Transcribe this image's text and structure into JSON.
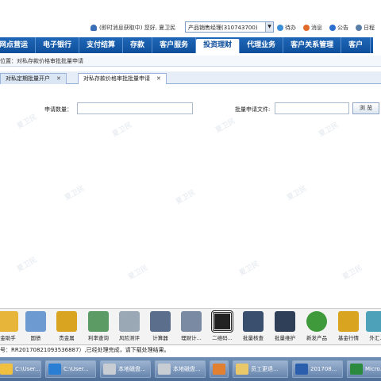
{
  "topbar": {
    "message": "(即时消息获取中)",
    "greeting": "您好, 夏卫民",
    "role": "产品销售经理(310743700)",
    "tools": [
      "待办",
      "消息",
      "公告",
      "日程"
    ]
  },
  "nav": [
    "网点营运",
    "电子银行",
    "支付结算",
    "存款",
    "客户服务",
    "投资理财",
    "代理业务",
    "客户关系管理",
    "客户"
  ],
  "active_nav": 5,
  "breadcrumb": "位置：对私存款价格审批批量申请",
  "tabs": [
    "对私定期批量开户",
    "对私存款价格审批批量申请"
  ],
  "tab_close": "✕",
  "form": {
    "qty_label": "申请数量：",
    "qty_value": "",
    "file_label": "批量申请文件:",
    "file_value": "",
    "browse": "浏  览"
  },
  "watermark": "夏卫民",
  "dock": [
    {
      "label": "金助手",
      "color": "#e7b53a"
    },
    {
      "label": "国债",
      "color": "#6c9ad1"
    },
    {
      "label": "贵金属",
      "color": "#d9a520"
    },
    {
      "label": "利率查询",
      "color": "#5c9c64"
    },
    {
      "label": "风险测评",
      "color": "#9aa7b5"
    },
    {
      "label": "计算器",
      "color": "#5b6f8c"
    },
    {
      "label": "理财计...",
      "color": "#7a8aa3"
    },
    {
      "label": "二维码...",
      "color": "#222222"
    },
    {
      "label": "批量核查",
      "color": "#3a4f6e"
    },
    {
      "label": "批量维护",
      "color": "#2f3f57"
    },
    {
      "label": "新发产品",
      "color": "#3f9a3b"
    },
    {
      "label": "基金行情",
      "color": "#d9a520"
    },
    {
      "label": "外汇..",
      "color": "#4da1b9"
    }
  ],
  "status": "号：RR20170821093536887）,已经处理完成，请下载处理结果。",
  "taskbar": [
    {
      "label": "C:\\User...",
      "color": "#f0c040"
    },
    {
      "label": "C:\\User...",
      "color": "#2a7fd4"
    },
    {
      "label": "本地磁盘...",
      "color": "#c8cdd4"
    },
    {
      "label": "本地磁盘...",
      "color": "#c8cdd4"
    },
    {
      "label": "",
      "color": "#e08030"
    },
    {
      "label": "员工更退...",
      "color": "#e9c86a"
    },
    {
      "label": "201708...",
      "color": "#2b5fae"
    },
    {
      "label": "Micro...",
      "color": "#2c8a3f"
    }
  ],
  "colors": {
    "nav": "#0e4f9b",
    "accent": "#1f67b8"
  }
}
